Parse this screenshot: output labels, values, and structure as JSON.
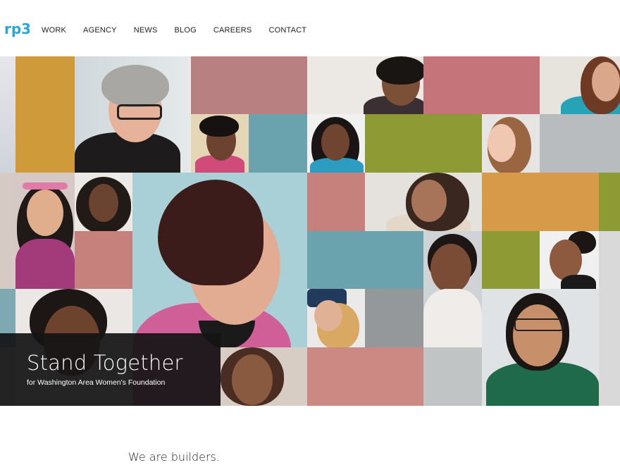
{
  "header": {
    "logo_text": "rp3",
    "nav": [
      {
        "label": "WORK"
      },
      {
        "label": "AGENCY"
      },
      {
        "label": "NEWS"
      },
      {
        "label": "BLOG"
      },
      {
        "label": "CAREERS"
      },
      {
        "label": "CONTACT"
      }
    ]
  },
  "hero": {
    "title": "Stand Together",
    "subtitle": "for Washington Area Women's Foundation"
  },
  "intro": {
    "tagline": "We are builders."
  },
  "colors": {
    "logo": "#29a8d8",
    "caption_bg": "#141416",
    "nav_text": "#222222"
  }
}
